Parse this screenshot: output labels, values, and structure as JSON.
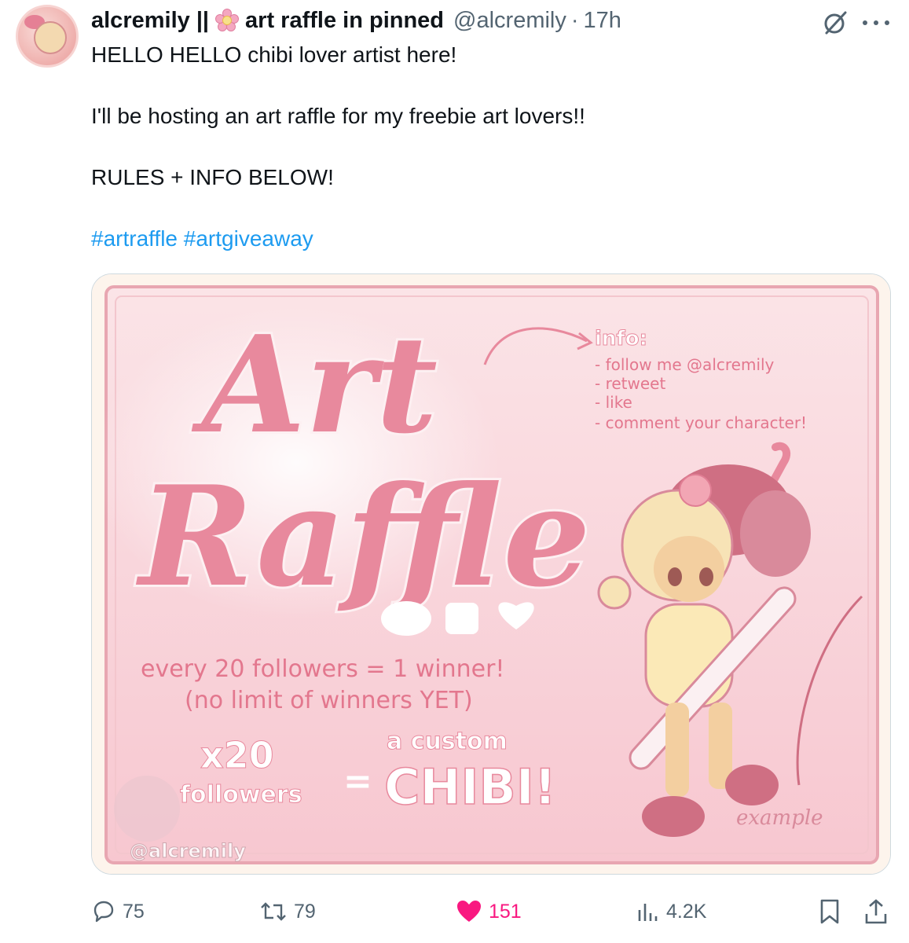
{
  "author": {
    "display_name_prefix": "alcremily ||",
    "display_name_suffix": "art raffle in pinned",
    "handle": "@alcremily",
    "separator": "·",
    "time": "17h"
  },
  "tweet": {
    "line1": "HELLO HELLO chibi lover artist here!",
    "line2": "I'll be hosting an art raffle for my freebie art lovers!!",
    "line3": "RULES + INFO BELOW!",
    "hashtag1": "#artraffle",
    "hashtag2": "#artgiveaway"
  },
  "image": {
    "title_line1": "Art",
    "title_line2": "Raffle",
    "info_heading": "info:",
    "info_items": [
      "- follow me @alcremily",
      "- retweet",
      "- like",
      "- comment your character!"
    ],
    "rule_line1": "every 20 followers = 1 winner!",
    "rule_line2": "(no limit of winners YET)",
    "multiplier": "x20",
    "followers_word": "followers",
    "equals": "=",
    "prize_small": "a custom",
    "prize_big": "CHIBI!",
    "example_label": "example",
    "watermark": "@alcremily"
  },
  "actions": {
    "replies": "75",
    "reposts": "79",
    "likes": "151",
    "views": "4.2K"
  },
  "colors": {
    "accent": "#1d9bf0",
    "like": "#f91880",
    "muted": "#536471",
    "raffle_pink": "#e37f96",
    "card_bg": "#f9d3db"
  },
  "icons": [
    "flower-icon",
    "grok-icon",
    "more-icon",
    "reply-icon",
    "repost-icon",
    "heart-icon",
    "views-icon",
    "bookmark-icon",
    "share-icon"
  ]
}
